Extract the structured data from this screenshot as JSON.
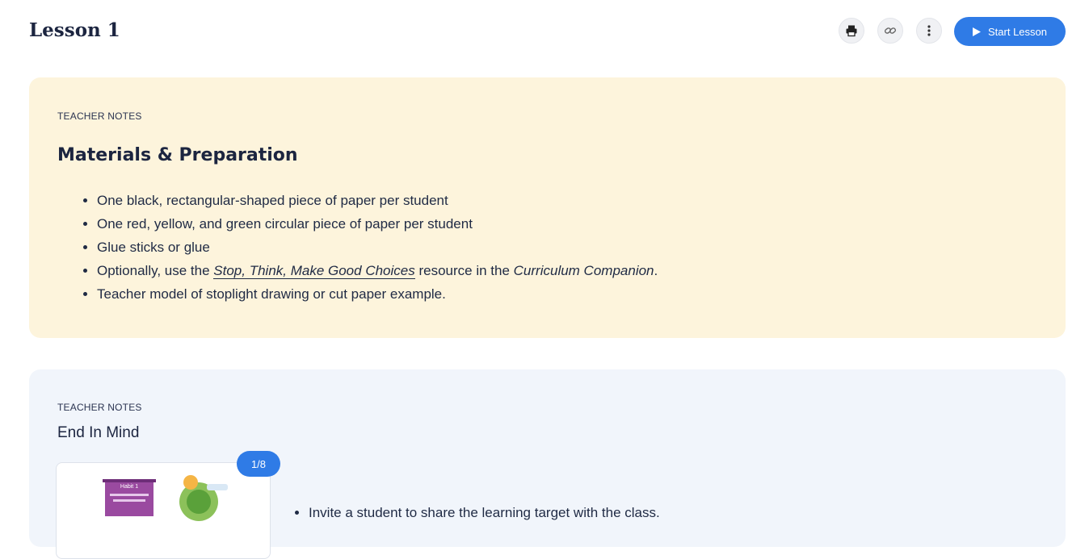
{
  "header": {
    "title": "Lesson 1",
    "icons": [
      "printer-icon",
      "link-icon",
      "more-vertical-icon"
    ],
    "start_button_label": "Start Lesson",
    "accent_color": "#2f7be6"
  },
  "materials_card": {
    "eyebrow": "TEACHER NOTES",
    "title": "Materials & Preparation",
    "background": "#fdf4dc",
    "items": [
      "One black, rectangular-shaped piece of paper per student",
      "One red, yellow, and green circular piece of paper per student",
      "Glue sticks or glue"
    ],
    "item4": {
      "prefix": "Optionally, use the ",
      "link_text": "Stop, Think, Make Good Choices",
      "middle": " resource in the ",
      "italic_text": "Curriculum Companion",
      "suffix": "."
    },
    "item5": "Teacher model of stoplight drawing or cut paper example."
  },
  "end_card": {
    "eyebrow": "TEACHER NOTES",
    "title": "End In Mind",
    "background": "#f1f5fb",
    "slide_counter": "1/8",
    "thumb_caption": "Habit 1",
    "items": [
      "Invite a student to share the learning target with the class."
    ]
  }
}
